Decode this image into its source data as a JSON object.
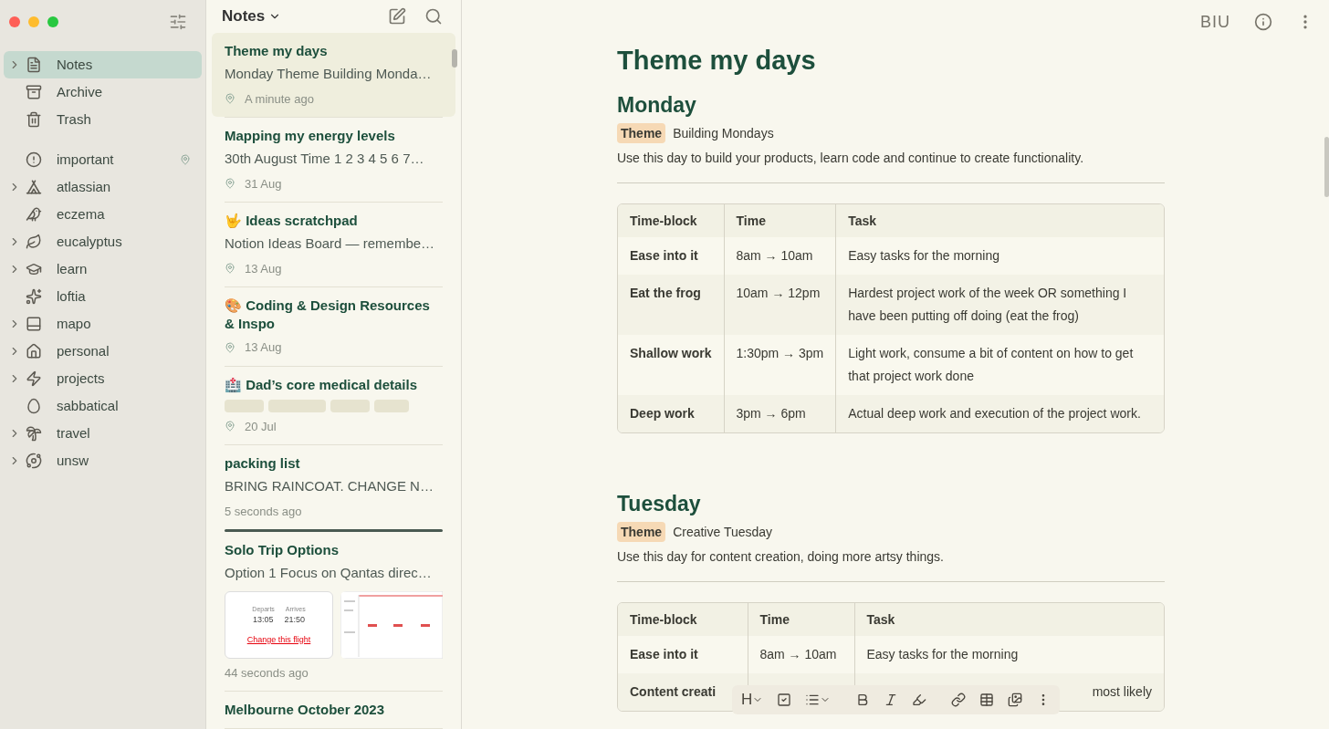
{
  "sidebar": {
    "items": [
      {
        "label": "Notes",
        "selected": true,
        "expandable": true,
        "pinned": false
      },
      {
        "label": "Archive",
        "selected": false,
        "expandable": false,
        "pinned": false
      },
      {
        "label": "Trash",
        "selected": false,
        "expandable": false,
        "pinned": false
      }
    ],
    "tags": [
      {
        "label": "important",
        "selected": false,
        "expandable": false,
        "pinned": true
      },
      {
        "label": "atlassian",
        "selected": false,
        "expandable": true,
        "pinned": false
      },
      {
        "label": "eczema",
        "selected": false,
        "expandable": false,
        "pinned": false
      },
      {
        "label": "eucalyptus",
        "selected": false,
        "expandable": true,
        "pinned": false
      },
      {
        "label": "learn",
        "selected": false,
        "expandable": true,
        "pinned": false
      },
      {
        "label": "loftia",
        "selected": false,
        "expandable": false,
        "pinned": false
      },
      {
        "label": "mapo",
        "selected": false,
        "expandable": true,
        "pinned": false
      },
      {
        "label": "personal",
        "selected": false,
        "expandable": true,
        "pinned": false
      },
      {
        "label": "projects",
        "selected": false,
        "expandable": true,
        "pinned": false
      },
      {
        "label": "sabbatical",
        "selected": false,
        "expandable": false,
        "pinned": false
      },
      {
        "label": "travel",
        "selected": false,
        "expandable": true,
        "pinned": false
      },
      {
        "label": "unsw",
        "selected": false,
        "expandable": true,
        "pinned": false
      }
    ]
  },
  "note_list": {
    "title": "Notes",
    "notes": [
      {
        "title": "Theme my days",
        "preview": "Monday Theme Building Monda…",
        "time": "A minute ago",
        "pinned": true,
        "selected": true,
        "kind": "text"
      },
      {
        "title": "Mapping my energy levels",
        "preview": "30th August Time 1 2 3 4 5 6 7…",
        "time": "31 Aug",
        "pinned": true,
        "selected": false,
        "kind": "text"
      },
      {
        "title": "🤟 Ideas scratchpad",
        "preview": "Notion Ideas Board — remembe…",
        "time": "13 Aug",
        "pinned": true,
        "selected": false,
        "kind": "text"
      },
      {
        "title": "🎨 Coding & Design Resources & Inspo",
        "time": "13 Aug",
        "pinned": true,
        "selected": false,
        "kind": "empty"
      },
      {
        "title": "🏥 Dad’s core medical details",
        "time": "20 Jul",
        "pinned": true,
        "selected": false,
        "kind": "redacted"
      },
      {
        "title": "packing list",
        "preview": "BRING RAINCOAT. CHANGE N…",
        "time": "5 seconds ago",
        "pinned": false,
        "selected": false,
        "kind": "text",
        "drop_indicator": true
      },
      {
        "title": "Solo Trip Options",
        "preview": "Option 1 Focus on Qantas direc…",
        "time": "44 seconds ago",
        "pinned": false,
        "selected": false,
        "kind": "images",
        "thumbnail": {
          "departs_label": "Departs",
          "arrives_label": "Arrives",
          "departs": "13:05",
          "arrives": "21:50",
          "link": "Change this flight"
        }
      },
      {
        "title": "Melbourne October 2023",
        "selected": false,
        "kind": "title_only"
      }
    ]
  },
  "toolbar": {
    "format": "BIU"
  },
  "editor": {
    "title": "Theme my days",
    "sections": [
      {
        "heading": "Monday",
        "badge": "Theme",
        "theme": "Building Mondays",
        "description": "Use this day to build your products, learn code and continue to create functionality.",
        "table": {
          "columns": [
            "Time-block",
            "Time",
            "Task"
          ],
          "rows": [
            [
              "Ease into it",
              "8am → 10am",
              "Easy  tasks for the morning"
            ],
            [
              "Eat the frog",
              "10am → 12pm",
              "Hardest project work of the week OR something I have been putting off doing (eat the frog)"
            ],
            [
              "Shallow work",
              "1:30pm → 3pm",
              "Light work, consume a bit of content on how to get that project work done"
            ],
            [
              "Deep work",
              "3pm → 6pm",
              "Actual deep work and execution of the project work."
            ]
          ]
        }
      },
      {
        "heading": "Tuesday",
        "badge": "Theme",
        "theme": "Creative Tuesday",
        "description": "Use this day for content creation, doing more artsy things.",
        "table": {
          "columns": [
            "Time-block",
            "Time",
            "Task"
          ],
          "rows": [
            [
              "Ease into it",
              "8am → 10am",
              "Easy  tasks for the morning"
            ],
            [
              "Content creati",
              "",
              "most likely"
            ]
          ]
        }
      }
    ]
  },
  "format_bar": {
    "heading": "H"
  }
}
